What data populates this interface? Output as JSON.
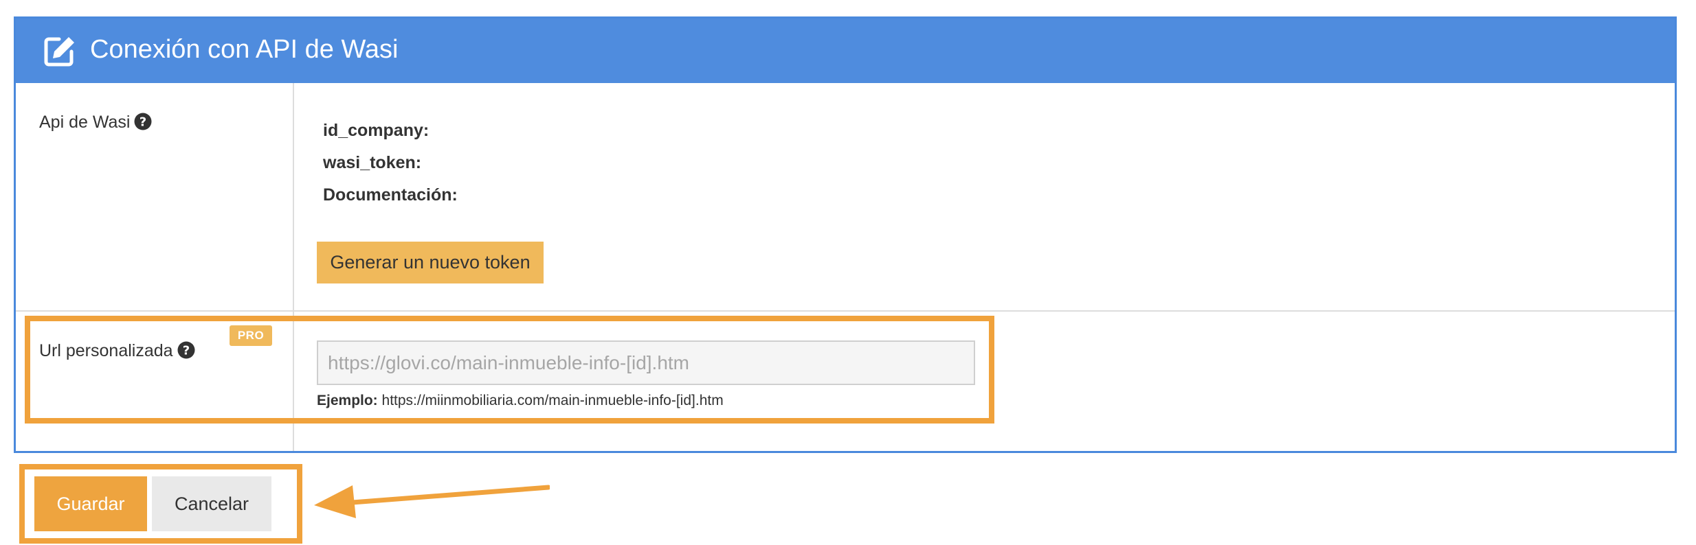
{
  "panel": {
    "title": "Conexión con API de Wasi",
    "header_icon": "edit-icon",
    "accent_color": "#4f8cde"
  },
  "api_section": {
    "label": "Api de Wasi",
    "help_icon": "question-circle-icon",
    "fields": [
      "id_company:",
      "wasi_token:",
      "Documentación:"
    ],
    "generate_token_label": "Generar un nuevo token"
  },
  "url_section": {
    "label": "Url personalizada",
    "help_icon": "question-circle-icon",
    "badge": "PRO",
    "placeholder": "https://glovi.co/main-inmueble-info-[id].htm",
    "example_label": "Ejemplo:",
    "example_value": "https://miinmobiliaria.com/main-inmueble-info-[id].htm"
  },
  "actions": {
    "save_label": "Guardar",
    "cancel_label": "Cancelar"
  },
  "annotation": {
    "highlight_color": "#f0a23c",
    "arrow_icon": "arrow-left-icon"
  }
}
